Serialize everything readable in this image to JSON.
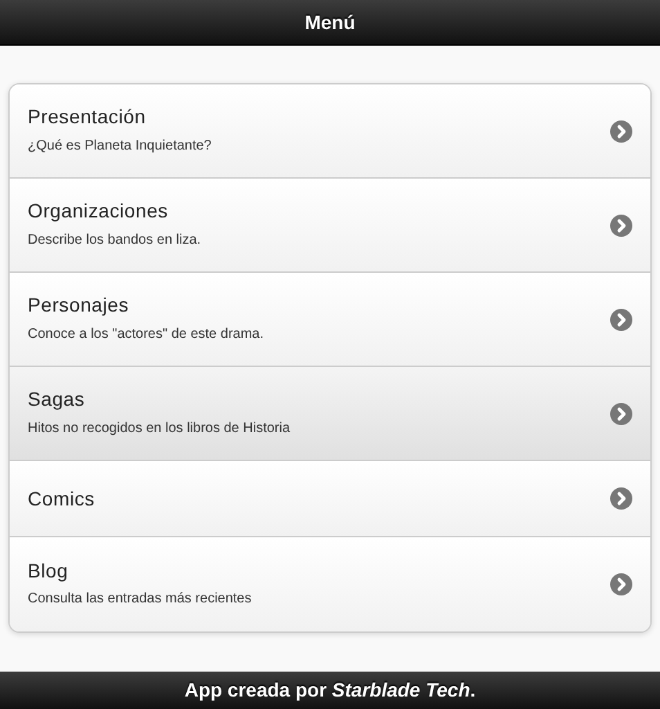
{
  "header": {
    "title": "Menú"
  },
  "menu": [
    {
      "title": "Presentación",
      "subtitle": "¿Qué es Planeta Inquietante?",
      "selected": false
    },
    {
      "title": "Organizaciones",
      "subtitle": "Describe los bandos en liza.",
      "selected": false
    },
    {
      "title": "Personajes",
      "subtitle": "Conoce a los \"actores\" de este drama.",
      "selected": false
    },
    {
      "title": "Sagas",
      "subtitle": "Hitos no recogidos en los libros de Historia",
      "selected": true
    },
    {
      "title": "Comics",
      "selected": false
    },
    {
      "title": "Blog",
      "subtitle": "Consulta las entradas más recientes",
      "selected": false
    }
  ],
  "footer": {
    "text": "App creada por *Starblade Tech*."
  }
}
